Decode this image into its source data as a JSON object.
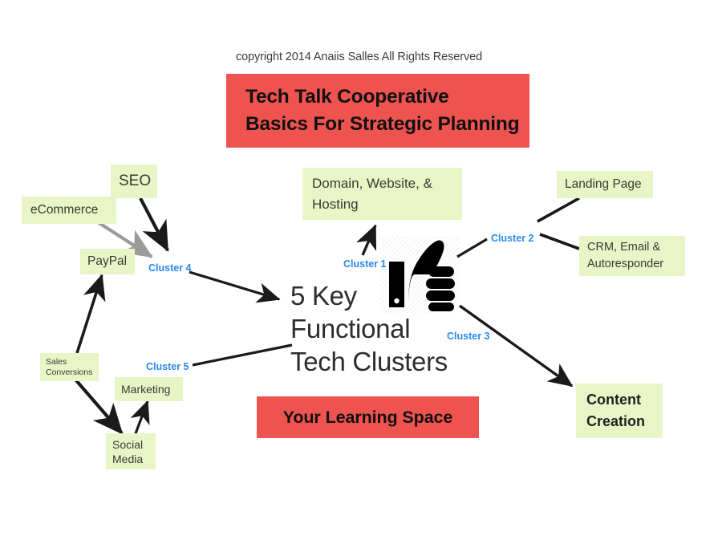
{
  "page": {
    "background": "#ffffff",
    "copyright": "copyright 2014 Anaiis Salles All Rights Reserved"
  },
  "colors": {
    "node_fill": "#e9f5c6",
    "banner_fill": "#ef5350",
    "cluster_label": "#2a8af0",
    "arrow_black": "#1a1a1a",
    "arrow_grey": "#9b9b9b",
    "title_text": "#2d2d2d"
  },
  "title_banner": {
    "line1": "Tech Talk Cooperative",
    "line2": "Basics For Strategic Planning"
  },
  "learning_banner": {
    "label": "Your Learning Space"
  },
  "center": {
    "line1": "5 Key",
    "line2": "Functional",
    "line3": "Tech Clusters",
    "icon": "thumbs-up-icon"
  },
  "clusters": [
    {
      "id": "cluster1",
      "label": "Cluster 1"
    },
    {
      "id": "cluster2",
      "label": "Cluster 2"
    },
    {
      "id": "cluster3",
      "label": "Cluster 3"
    },
    {
      "id": "cluster4",
      "label": "Cluster 4"
    },
    {
      "id": "cluster5",
      "label": "Cluster 5"
    }
  ],
  "nodes": {
    "seo": {
      "label": "SEO"
    },
    "ecommerce": {
      "label": "eCommerce"
    },
    "paypal": {
      "label": "PayPal"
    },
    "sales_conversions": {
      "line1": "Sales",
      "line2": "Conversions"
    },
    "marketing": {
      "label": "Marketing"
    },
    "social_media": {
      "line1": "Social",
      "line2": "Media"
    },
    "domain_website_hosting": {
      "line1": "Domain, Website, &",
      "line2": "Hosting"
    },
    "landing_page": {
      "label": "Landing Page"
    },
    "crm_email_autoresponder": {
      "line1": "CRM, Email &",
      "line2": "Autoresponder"
    },
    "content_creation": {
      "line1": "Content",
      "line2": "Creation"
    }
  }
}
